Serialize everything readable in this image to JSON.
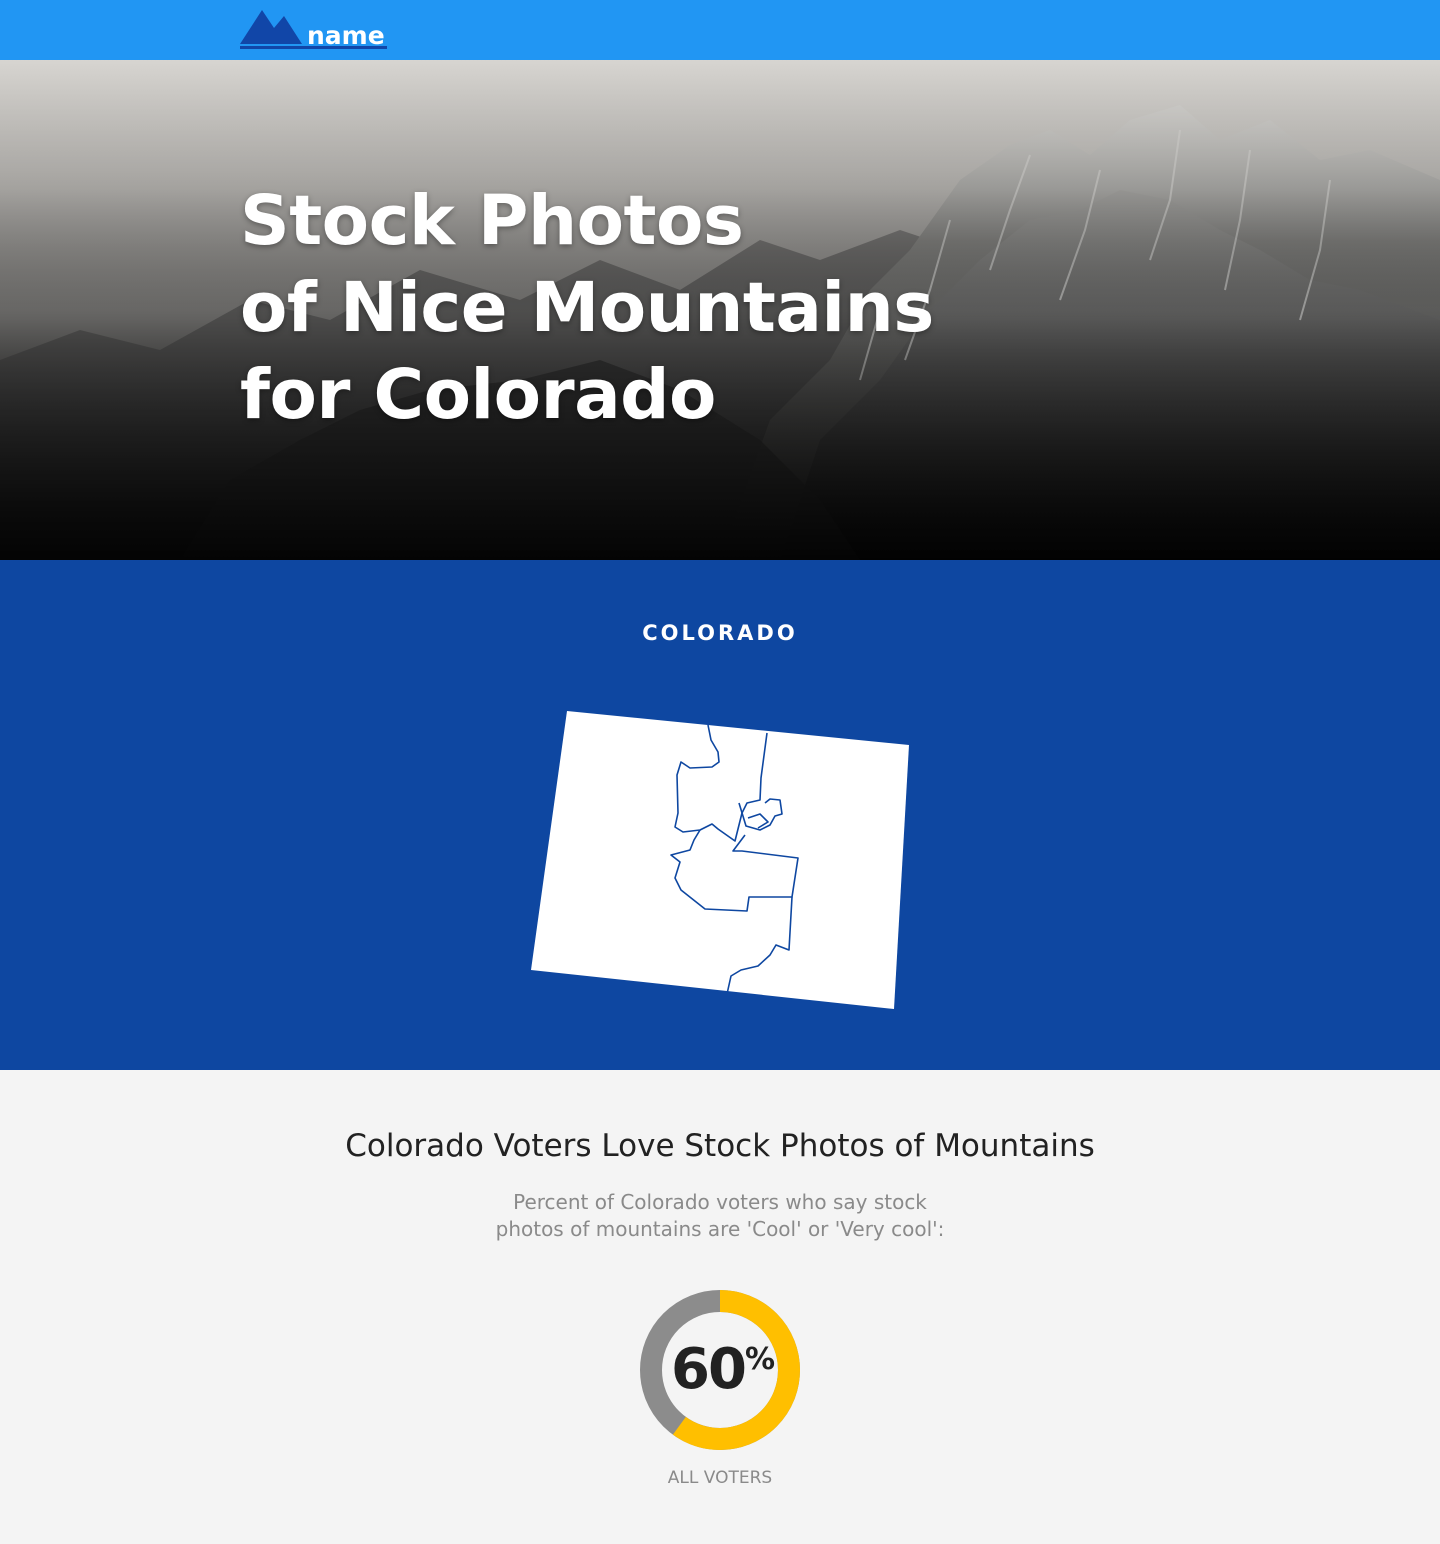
{
  "colors": {
    "topbar": "#2196f3",
    "brand_dark": "#1146a8",
    "state_bg": "#0e47a1",
    "donut_fill": "#ffbf00",
    "donut_rest": "#8c8c8c"
  },
  "header": {
    "logo_text": "name",
    "logo_icon": "mountain-logo-icon"
  },
  "hero": {
    "title_lines": [
      "Stock Photos",
      "of Nice Mountains",
      "for Colorado"
    ]
  },
  "state": {
    "label": "COLORADO",
    "map_icon": "colorado-district-map"
  },
  "survey": {
    "title": "Colorado Voters Love Stock Photos of Mountains",
    "subtitle_lines": [
      "Percent of Colorado voters who say stock",
      "photos of mountains are 'Cool' or 'Very cool':"
    ],
    "stat": {
      "value": 60,
      "value_text": "60",
      "unit": "%",
      "label": "ALL VOTERS"
    }
  }
}
